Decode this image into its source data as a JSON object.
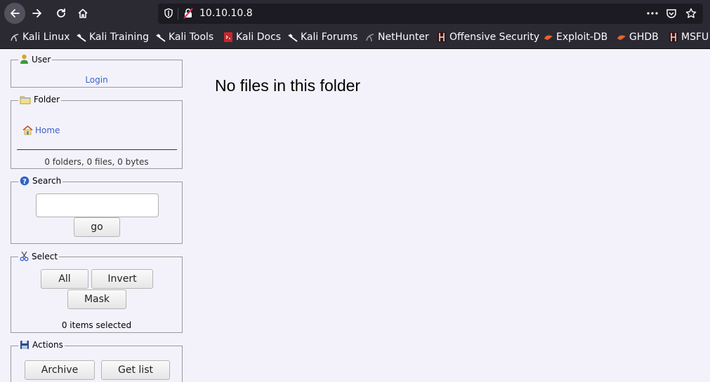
{
  "browser": {
    "url": "10.10.10.8",
    "bookmarks": [
      "Kali Linux",
      "Kali Training",
      "Kali Tools",
      "Kali Docs",
      "Kali Forums",
      "NetHunter",
      "Offensive Security",
      "Exploit-DB",
      "GHDB",
      "MSFU"
    ]
  },
  "sidebar": {
    "user": {
      "title": "User",
      "login_label": "Login"
    },
    "folder": {
      "title": "Folder",
      "home_label": "Home",
      "stats": "0 folders, 0 files, 0 bytes"
    },
    "search": {
      "title": "Search",
      "go_label": "go",
      "value": ""
    },
    "select": {
      "title": "Select",
      "all_label": "All",
      "invert_label": "Invert",
      "mask_label": "Mask",
      "status": "0 items selected"
    },
    "actions": {
      "title": "Actions",
      "archive_label": "Archive",
      "getlist_label": "Get list"
    }
  },
  "main": {
    "empty_message": "No files in this folder"
  },
  "colors": {
    "accent_link": "#3366cc",
    "page_bg": "#f3f2fb",
    "chrome_bg": "#2b2a33"
  }
}
